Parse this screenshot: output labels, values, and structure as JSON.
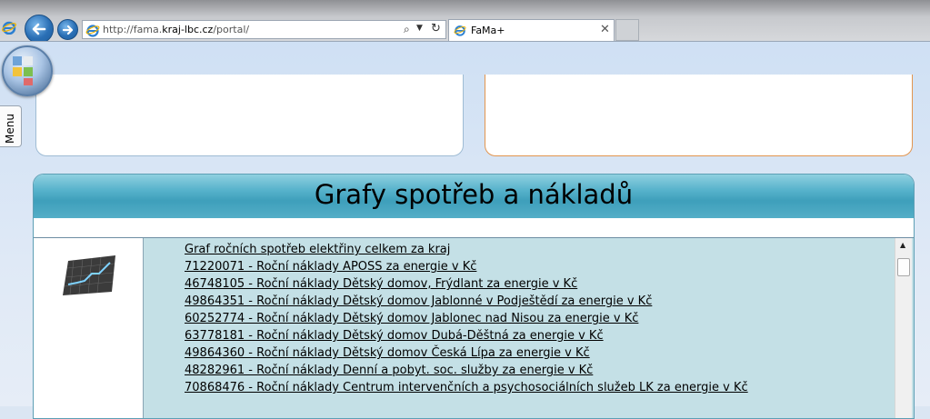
{
  "browser": {
    "address": {
      "url_prefix": "http://fama.",
      "url_domain": "kraj-lbc.cz",
      "url_suffix": "/portal/"
    },
    "tab": {
      "title": "FaMa+"
    },
    "icons": {
      "back": "back-arrow-icon",
      "forward": "forward-arrow-icon",
      "search": "search-icon",
      "refresh": "refresh-icon",
      "close": "close-icon",
      "ie": "ie-icon"
    }
  },
  "page": {
    "menu_label": "Menu",
    "graphs": {
      "title": "Grafy spotřeb a nákladů",
      "items": [
        "Graf ročních spotřeb elektřiny celkem za kraj",
        "71220071 - Roční náklady APOSS za energie v Kč",
        "46748105 - Roční náklady Dětský domov, Frýdlant za energie v Kč",
        "49864351 - Roční náklady Dětský domov Jablonné v Podještědí za energie v Kč",
        "60252774 - Roční náklady Dětský domov Jablonec nad Nisou za energie v Kč",
        "63778181 - Roční náklady Dětský domov Dubá-Děštná za energie v Kč",
        "49864360 - Roční náklady Dětský domov Česká Lípa za energie v Kč",
        "48282961 - Roční náklady Denní a pobyt. soc. služby za energie v Kč",
        "70868476 - Roční náklady Centrum intervenčních a psychosociálních služeb LK za energie v Kč"
      ]
    }
  },
  "colors": {
    "header_teal": "#3e9fbb",
    "list_bg": "#c4e0e6",
    "right_panel_border": "#e2954f"
  }
}
